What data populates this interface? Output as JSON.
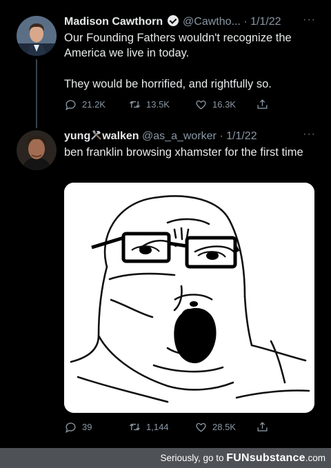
{
  "tweet1": {
    "name": "Madison Cawthorn",
    "handle": "@Cawtho...",
    "date": "· 1/1/22",
    "more": "···",
    "text_line1": "Our Founding Fathers wouldn't recognize the America we live in today.",
    "text_line2": "They would be horrified, and rightfully so.",
    "replies": "21.2K",
    "retweets": "13.5K",
    "likes": "16.3K"
  },
  "tweet2": {
    "name_prefix": "yung",
    "name_suffix": "walken",
    "handle": "@as_a_worker",
    "date": "· 1/1/22",
    "more": "···",
    "text": "ben franklin browsing xhamster for the first time",
    "replies": "39",
    "retweets": "1,144",
    "likes": "28.5K"
  },
  "footer": {
    "text": "Seriously, go to",
    "brand_fun": "FUN",
    "brand_rest": "substance",
    "brand_tld": ".com"
  },
  "colors": {
    "background": "#000000",
    "text": "#e7e9ea",
    "secondary": "#8b98a5",
    "footer_bg": "#4e5156"
  }
}
